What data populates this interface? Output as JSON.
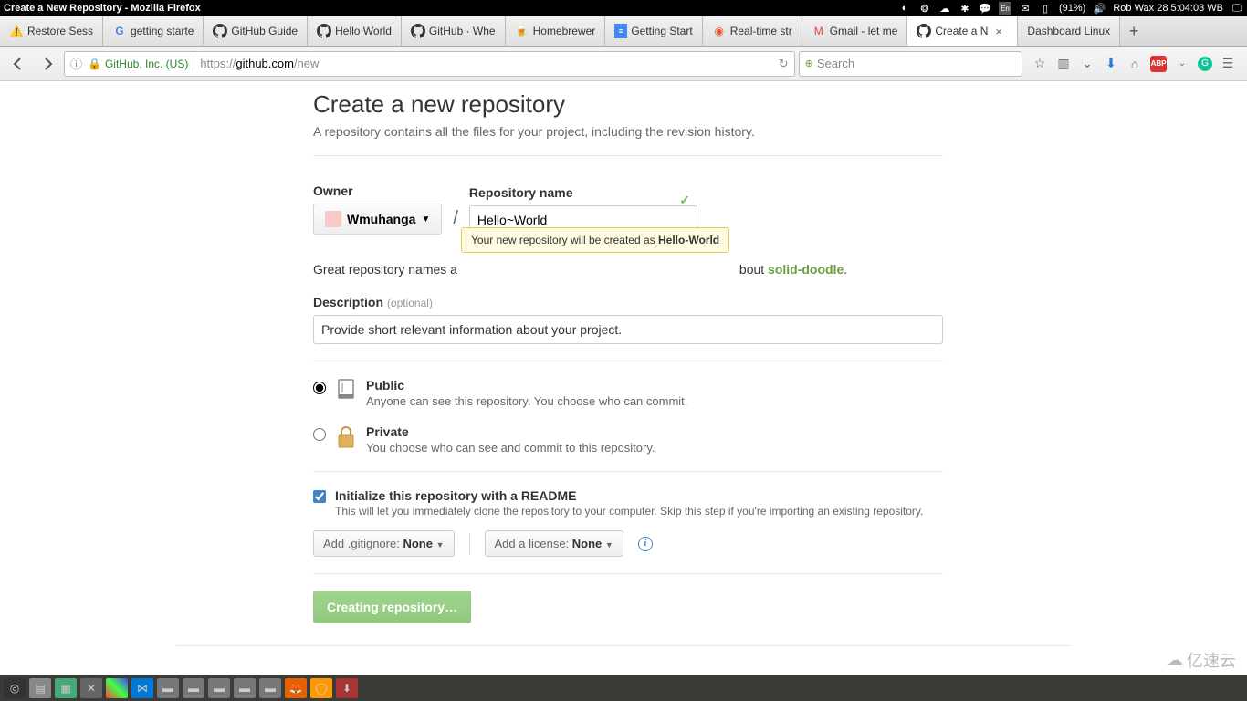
{
  "system": {
    "window_title": "Create a New Repository - Mozilla Firefox",
    "battery": "(91%)",
    "user_time": "Rob Wax 28  5:04:03 WB"
  },
  "tabs": [
    {
      "icon": "warning",
      "label": "Restore Sess"
    },
    {
      "icon": "google",
      "label": "getting starte"
    },
    {
      "icon": "github",
      "label": "GitHub Guide"
    },
    {
      "icon": "github",
      "label": "Hello World"
    },
    {
      "icon": "github",
      "label": "GitHub · Whe"
    },
    {
      "icon": "homebrew",
      "label": "Homebrewer"
    },
    {
      "icon": "gdoc",
      "label": "Getting Start"
    },
    {
      "icon": "realtime",
      "label": "Real-time str"
    },
    {
      "icon": "gmail",
      "label": "Gmail - let me"
    },
    {
      "icon": "github",
      "label": "Create a N",
      "active": true,
      "close": true
    },
    {
      "icon": "none",
      "label": "Dashboard Linux"
    }
  ],
  "url": {
    "identity": "GitHub, Inc. (US)",
    "prefix": "https://",
    "domain": "github.com",
    "path": "/new"
  },
  "search_placeholder": "Search",
  "page": {
    "title": "Create a new repository",
    "subtitle": "A repository contains all the files for your project, including the revision history.",
    "owner_label": "Owner",
    "owner_name": "Wmuhanga",
    "repo_label": "Repository name",
    "repo_value": "Hello~World",
    "tooltip_prefix": "Your new repository will be created as ",
    "tooltip_name": "Hello-World",
    "hint_prefix": "Great repository names a",
    "hint_mid": "bout ",
    "hint_suggestion": "solid-doodle",
    "desc_label": "Description",
    "desc_optional": "(optional)",
    "desc_value": "Provide short relevant information about your project.",
    "public_title": "Public",
    "public_desc": "Anyone can see this repository. You choose who can commit.",
    "private_title": "Private",
    "private_desc": "You choose who can see and commit to this repository.",
    "init_title": "Initialize this repository with a README",
    "init_desc": "This will let you immediately clone the repository to your computer. Skip this step if you're importing an existing repository.",
    "gitignore_label": "Add .gitignore: ",
    "gitignore_value": "None",
    "license_label": "Add a license: ",
    "license_value": "None",
    "submit_label": "Creating repository…"
  },
  "watermark": "亿速云"
}
